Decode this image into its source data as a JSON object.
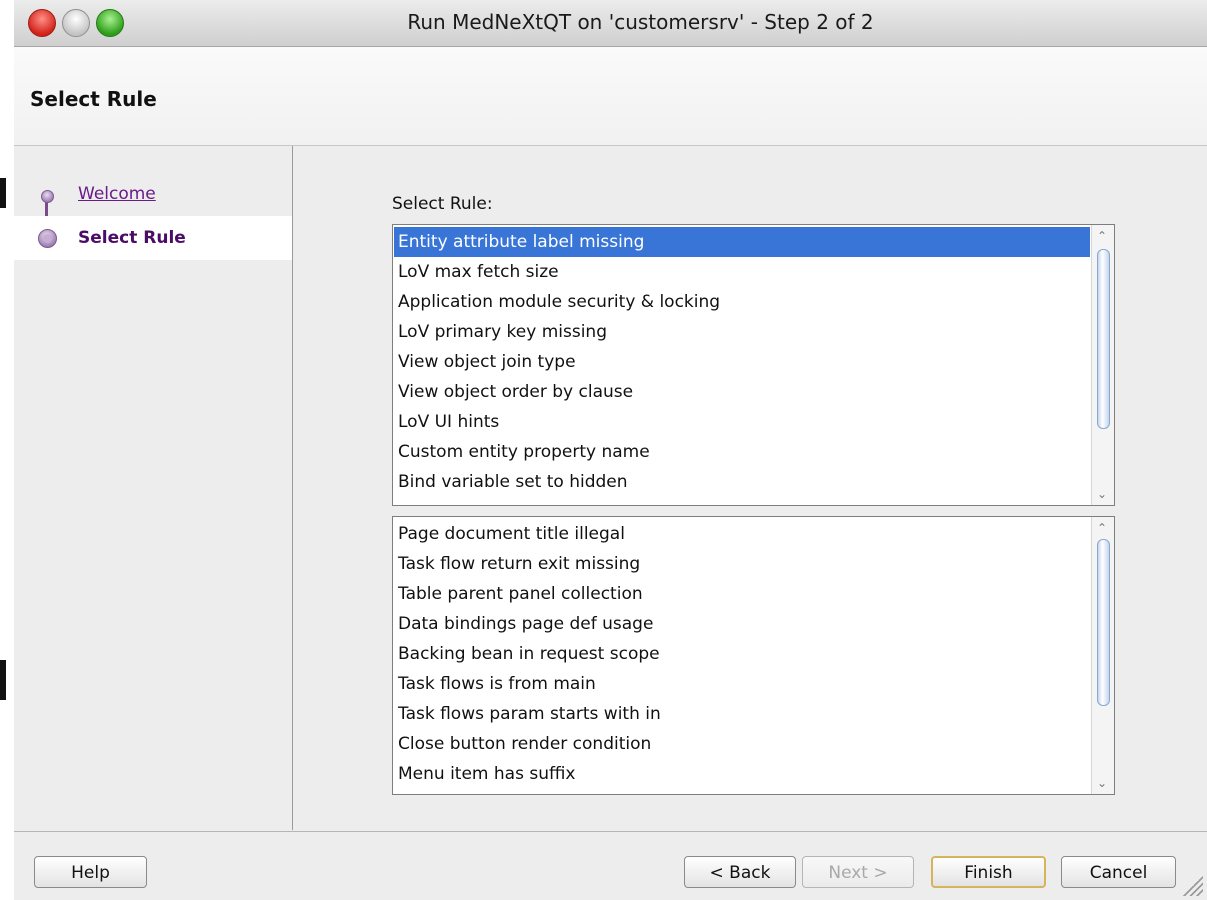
{
  "window": {
    "title": "Run MedNeXtQT on 'customersrv' - Step 2 of 2"
  },
  "header": {
    "title": "Select Rule"
  },
  "sidebar": {
    "steps": [
      {
        "label": "Welcome",
        "state": "link"
      },
      {
        "label": "Select Rule",
        "state": "current"
      }
    ]
  },
  "main": {
    "select_label": "Select Rule:",
    "list1": {
      "items": [
        "Entity attribute label missing",
        "LoV max fetch size",
        "Application module security & locking",
        "LoV primary key missing",
        "View object join type",
        "View object order by clause",
        "LoV UI hints",
        "Custom entity property name",
        "Bind variable set to hidden"
      ],
      "selected": "Entity attribute label missing"
    },
    "list2": {
      "items": [
        "Page document title illegal",
        "Task flow return exit missing",
        "Table parent panel collection",
        "Data bindings page def usage",
        "Backing bean in request scope",
        "Task flows is from main",
        "Task flows param starts with in",
        "Close button render condition",
        "Menu item has suffix"
      ]
    }
  },
  "footer": {
    "help": "Help",
    "back": "< Back",
    "next": "Next >",
    "finish": "Finish",
    "cancel": "Cancel"
  },
  "colors": {
    "selection": "#3875d7",
    "link": "#6a1b8a",
    "default_button_border": "#d6b45a"
  },
  "icons": {
    "close": "close-window-icon",
    "minimize": "minimize-window-icon",
    "zoom": "zoom-window-icon",
    "step_dot": "step-dot-icon",
    "scroll_up": "scroll-up-arrow-icon",
    "scroll_down": "scroll-down-arrow-icon",
    "resize": "resize-grip-icon"
  }
}
